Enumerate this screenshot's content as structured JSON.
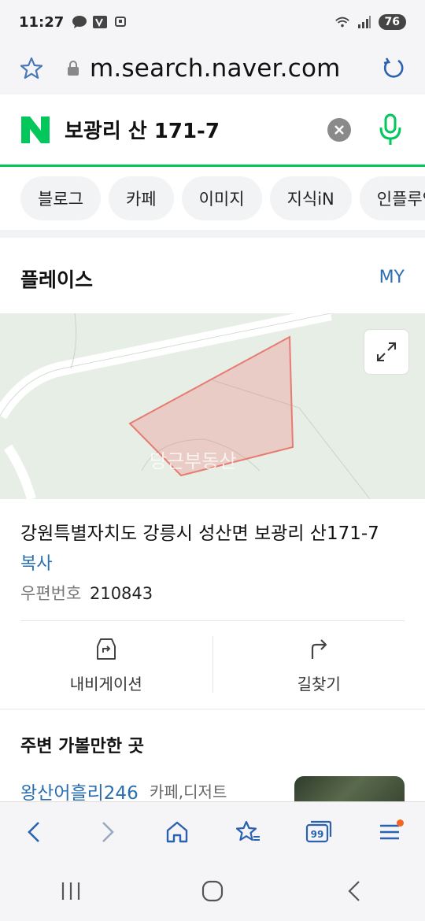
{
  "status_bar": {
    "time": "11:27",
    "battery": "76"
  },
  "url_bar": {
    "url": "m.search.naver.com"
  },
  "search": {
    "query": "보광리 산 171-7"
  },
  "tabs": [
    {
      "label": "블로그"
    },
    {
      "label": "카페"
    },
    {
      "label": "이미지"
    },
    {
      "label": "지식iN"
    },
    {
      "label": "인플루언서"
    }
  ],
  "place": {
    "section_title": "플레이스",
    "my_label": "MY",
    "map_watermark": "당근부동산",
    "address": "강원특별자치도 강릉시 성산면 보광리 산171-7",
    "copy_label": "복사",
    "postal_label": "우편번호",
    "postal_code": "210843",
    "actions": [
      {
        "label": "내비게이션",
        "icon": "car-navigation-icon"
      },
      {
        "label": "길찾기",
        "icon": "turn-right-arrow-icon"
      }
    ]
  },
  "nearby": {
    "title": "주변 가볼만한 곳",
    "items": [
      {
        "name": "왕산어흘리246",
        "category": "카페,디저트"
      }
    ]
  },
  "toolbar": {
    "icons": [
      "back-icon",
      "forward-icon",
      "home-icon",
      "bookmark-star-icon",
      "tabs-icon",
      "menu-icon"
    ],
    "tabs_count": "99"
  },
  "colors": {
    "naver_green": "#03c75a",
    "link_blue": "#2a6fb0",
    "notification": "#f26522"
  }
}
